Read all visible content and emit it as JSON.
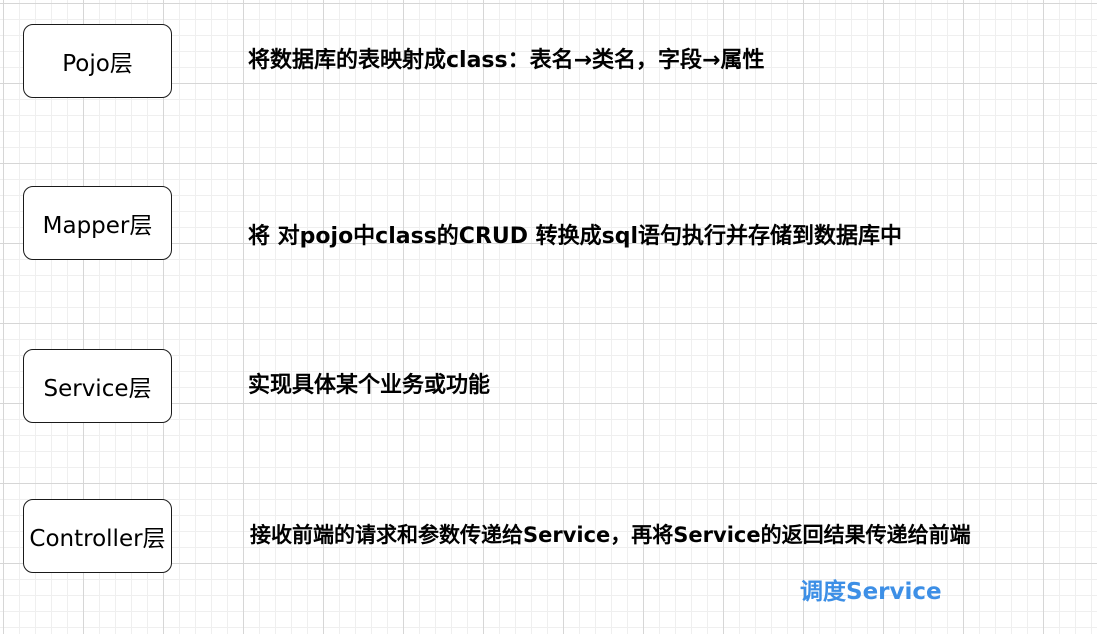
{
  "layers": [
    {
      "name": "Pojo层",
      "description": "将数据库的表映射成class：表名→类名，字段→属性"
    },
    {
      "name": "Mapper层",
      "description": "将 对pojo中class的CRUD 转换成sql语句执行并存储到数据库中"
    },
    {
      "name": "Service层",
      "description": "实现具体某个业务或功能"
    },
    {
      "name": "Controller层",
      "description": "接收前端的请求和参数传递给Service，再将Service的返回结果传递给前端"
    }
  ],
  "annotation": {
    "text": "调度Service",
    "color": "#3d8fe6"
  },
  "colors": {
    "grid_major": "#d6d6d6",
    "grid_minor": "#efefef",
    "box_border": "#1a1a1a",
    "text": "#000000"
  }
}
